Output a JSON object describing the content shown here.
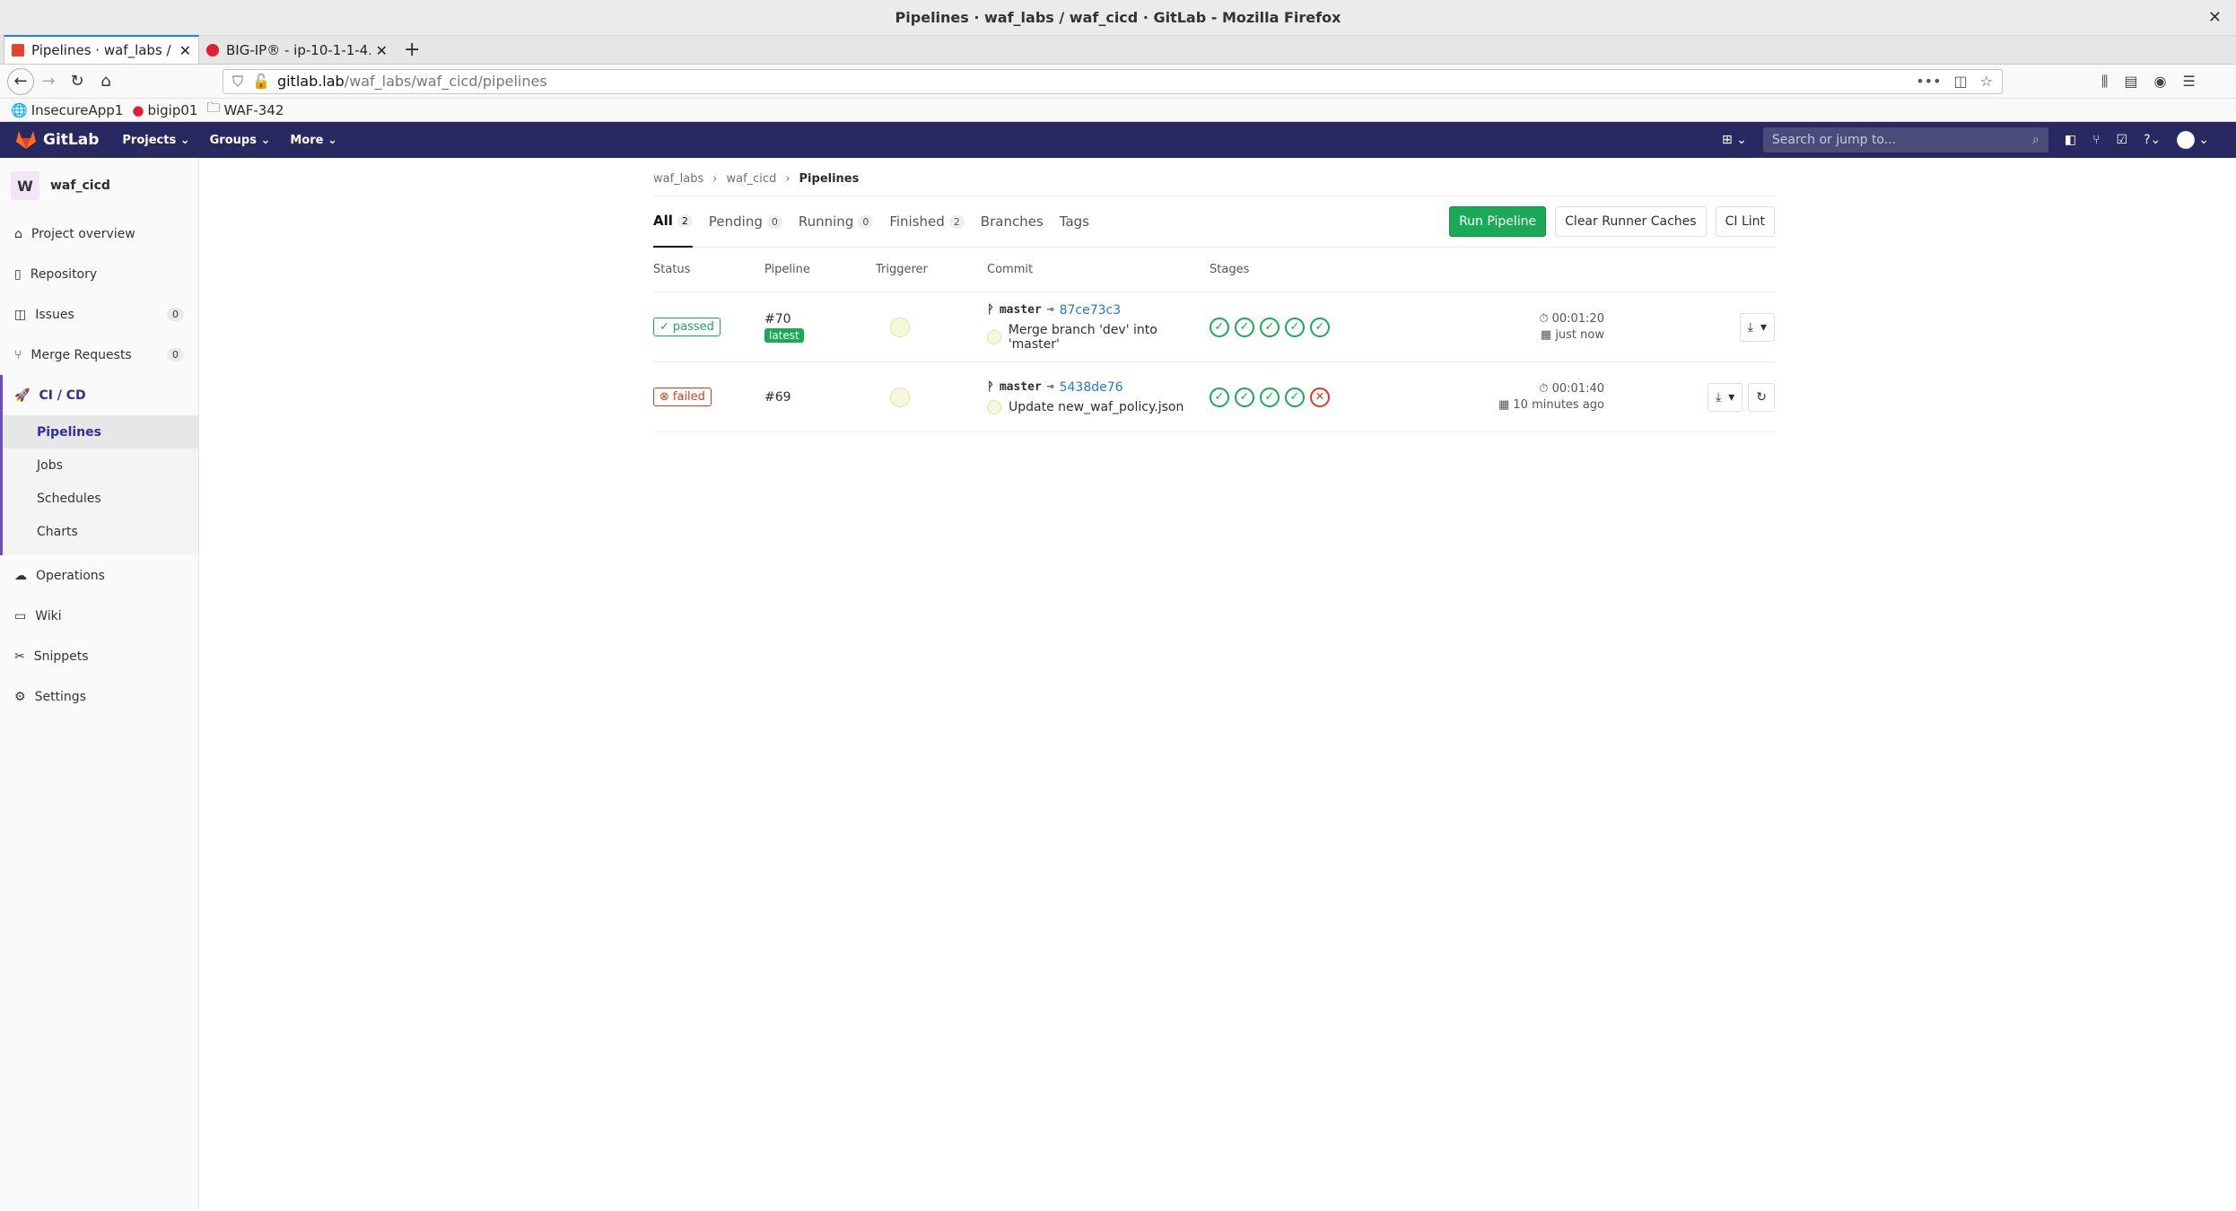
{
  "window": {
    "title": "Pipelines · waf_labs / waf_cicd · GitLab - Mozilla Firefox"
  },
  "tabs": [
    {
      "title": "Pipelines · waf_labs / w"
    },
    {
      "title": "BIG-IP® - ip-10-1-1-4."
    }
  ],
  "url": {
    "host": "gitlab.lab",
    "path": "/waf_labs/waf_cicd/pipelines"
  },
  "bookmarks": [
    "InsecureApp1",
    "bigip01",
    "WAF-342"
  ],
  "gitlab": {
    "brand": "GitLab",
    "nav": [
      "Projects",
      "Groups",
      "More"
    ],
    "search_placeholder": "Search or jump to..."
  },
  "sidebar": {
    "avatar": "W",
    "project": "waf_cicd",
    "items_top": [
      {
        "label": "Project overview",
        "icon": "home-icon"
      },
      {
        "label": "Repository",
        "icon": "book-icon"
      },
      {
        "label": "Issues",
        "icon": "issues-icon",
        "count": "0"
      },
      {
        "label": "Merge Requests",
        "icon": "merge-icon",
        "count": "0"
      }
    ],
    "cicd_label": "CI / CD",
    "cicd_sub": [
      "Pipelines",
      "Jobs",
      "Schedules",
      "Charts"
    ],
    "items_bottom": [
      {
        "label": "Operations",
        "icon": "cloud-icon"
      },
      {
        "label": "Wiki",
        "icon": "wiki-icon"
      },
      {
        "label": "Snippets",
        "icon": "scissors-icon"
      },
      {
        "label": "Settings",
        "icon": "gear-icon"
      }
    ]
  },
  "breadcrumb": [
    "waf_labs",
    "waf_cicd",
    "Pipelines"
  ],
  "pipeline_tabs": [
    {
      "label": "All",
      "count": "2"
    },
    {
      "label": "Pending",
      "count": "0"
    },
    {
      "label": "Running",
      "count": "0"
    },
    {
      "label": "Finished",
      "count": "2"
    },
    {
      "label": "Branches"
    },
    {
      "label": "Tags"
    }
  ],
  "buttons": {
    "run": "Run Pipeline",
    "clear": "Clear Runner Caches",
    "lint": "CI Lint"
  },
  "columns": [
    "Status",
    "Pipeline",
    "Triggerer",
    "Commit",
    "Stages"
  ],
  "pipelines": [
    {
      "status": "passed",
      "id": "#70",
      "badge": "latest",
      "branch": "master",
      "sha": "87ce73c3",
      "message": "Merge branch 'dev' into 'master'",
      "duration": "00:01:20",
      "finished": "just now"
    },
    {
      "status": "failed",
      "id": "#69",
      "branch": "master",
      "sha": "5438de76",
      "message": "Update new_waf_policy.json",
      "duration": "00:01:40",
      "finished": "10 minutes ago"
    }
  ],
  "colors": {
    "header": "#292961",
    "success": "#1aaa55",
    "danger": "#db3b21",
    "link": "#1f78d1"
  }
}
